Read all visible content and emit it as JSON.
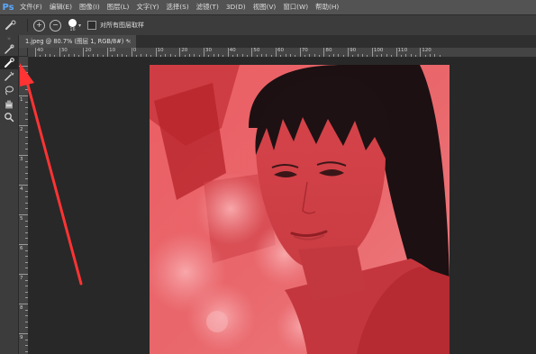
{
  "app": {
    "logo": "Ps"
  },
  "menu": [
    "文件(F)",
    "编辑(E)",
    "图像(I)",
    "图层(L)",
    "文字(Y)",
    "选择(S)",
    "滤镜(T)",
    "3D(D)",
    "视图(V)",
    "窗口(W)",
    "帮助(H)"
  ],
  "options": {
    "brush_size": "16",
    "checkbox_label": "对所有图层取样",
    "add_symbol": "+",
    "subtract_symbol": "−"
  },
  "tab": {
    "title": "1.jpeg @ 80.7% (图层 1, RGB/8#) *",
    "close": "×"
  },
  "ruler_h": [
    "40",
    "30",
    "20",
    "10",
    "0",
    "10",
    "20",
    "30",
    "40",
    "50",
    "60",
    "70",
    "80",
    "90",
    "100",
    "110",
    "120"
  ],
  "ruler_v": [
    "0",
    "1",
    "2",
    "3",
    "4",
    "5",
    "6",
    "7",
    "8",
    "9"
  ],
  "colors": {
    "quickmask_overlay": "#e8494e",
    "annotation_arrow": "#ff3333"
  }
}
